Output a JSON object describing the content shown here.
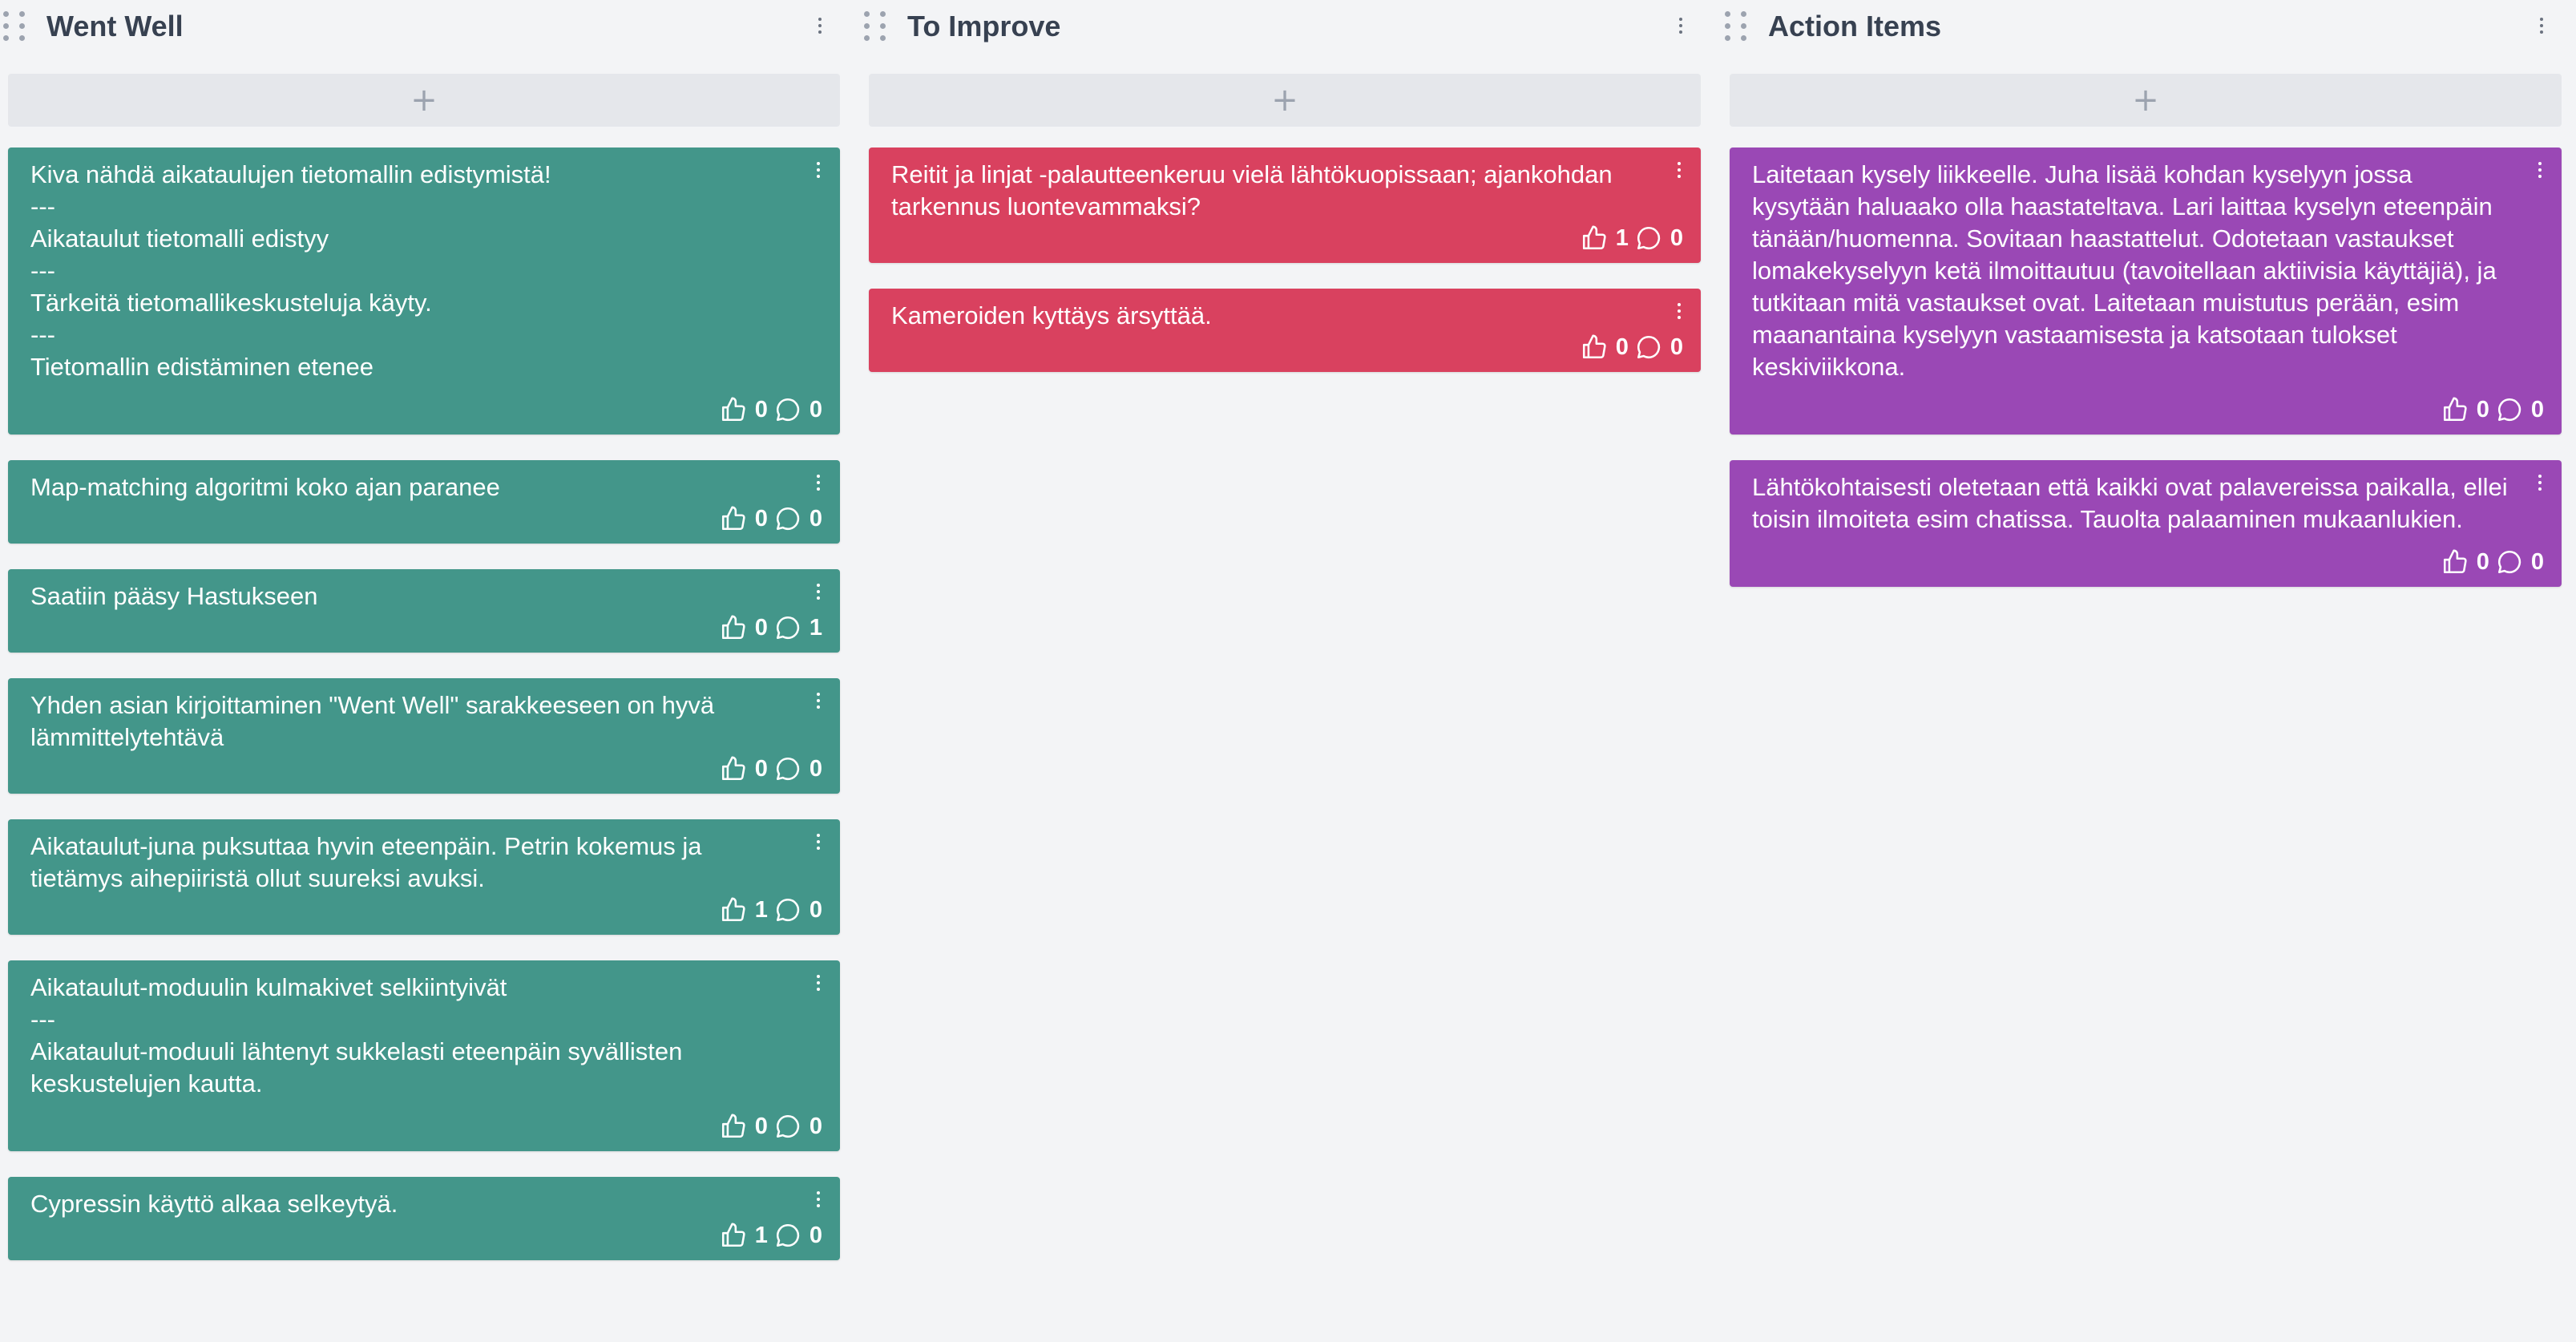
{
  "colors": {
    "went_well": "#43968a",
    "to_improve": "#d9415f",
    "action_items": "#9a48b5"
  },
  "icons": {
    "like": "thumbs-up-icon",
    "comment": "comment-bubble-icon",
    "menu": "vertical-ellipsis-icon",
    "drag": "drag-handle-icon",
    "add": "plus-icon"
  },
  "columns": [
    {
      "title": "Went Well",
      "add_label": "+",
      "cards": [
        {
          "text": "Kiva nähdä aikataulujen tietomallin edistymistä!\n---\nAikataulut tietomalli edistyy\n---\nTärkeitä tietomallikeskusteluja käyty.\n---\nTietomallin edistäminen etenee",
          "likes": "0",
          "comments": "0"
        },
        {
          "text": "Map-matching algoritmi koko ajan paranee",
          "likes": "0",
          "comments": "0"
        },
        {
          "text": "Saatiin pääsy Hastukseen",
          "likes": "0",
          "comments": "1"
        },
        {
          "text": "Yhden asian kirjoittaminen \"Went Well\" sarakkeeseen on hyvä lämmittelytehtävä",
          "likes": "0",
          "comments": "0"
        },
        {
          "text": "Aikataulut-juna puksuttaa hyvin eteenpäin. Petrin kokemus ja tietämys aihepiiristä ollut suureksi avuksi.",
          "likes": "1",
          "comments": "0"
        },
        {
          "text": "Aikataulut-moduulin kulmakivet selkiintyivät\n---\nAikataulut-moduuli lähtenyt sukkelasti eteenpäin syvällisten keskustelujen kautta.",
          "likes": "0",
          "comments": "0"
        },
        {
          "text": "Cypressin käyttö alkaa selkeytyä.",
          "likes": "1",
          "comments": "0"
        }
      ]
    },
    {
      "title": "To Improve",
      "add_label": "+",
      "cards": [
        {
          "text": "Reitit ja linjat -palautteenkeruu vielä lähtökuopissaan; ajankohdan tarkennus luontevammaksi?",
          "likes": "1",
          "comments": "0"
        },
        {
          "text": "Kameroiden kyttäys ärsyttää.",
          "likes": "0",
          "comments": "0"
        }
      ]
    },
    {
      "title": "Action Items",
      "add_label": "+",
      "cards": [
        {
          "text": "Laitetaan kysely liikkeelle. Juha lisää kohdan kyselyyn jossa kysytään haluaako olla haastateltava. Lari laittaa kyselyn eteenpäin tänään/huomenna. Sovitaan haastattelut. Odotetaan vastaukset lomakekyselyyn ketä ilmoittautuu (tavoitellaan aktiivisia käyttäjiä), ja tutkitaan mitä vastaukset ovat. Laitetaan muistutus perään, esim maanantaina kyselyyn vastaamisesta ja katsotaan tulokset keskiviikkona.",
          "likes": "0",
          "comments": "0"
        },
        {
          "text": "Lähtökohtaisesti oletetaan että kaikki ovat palavereissa paikalla, ellei toisin ilmoiteta esim chatissa. Tauolta palaaminen mukaanlukien.",
          "likes": "0",
          "comments": "0"
        }
      ]
    }
  ]
}
